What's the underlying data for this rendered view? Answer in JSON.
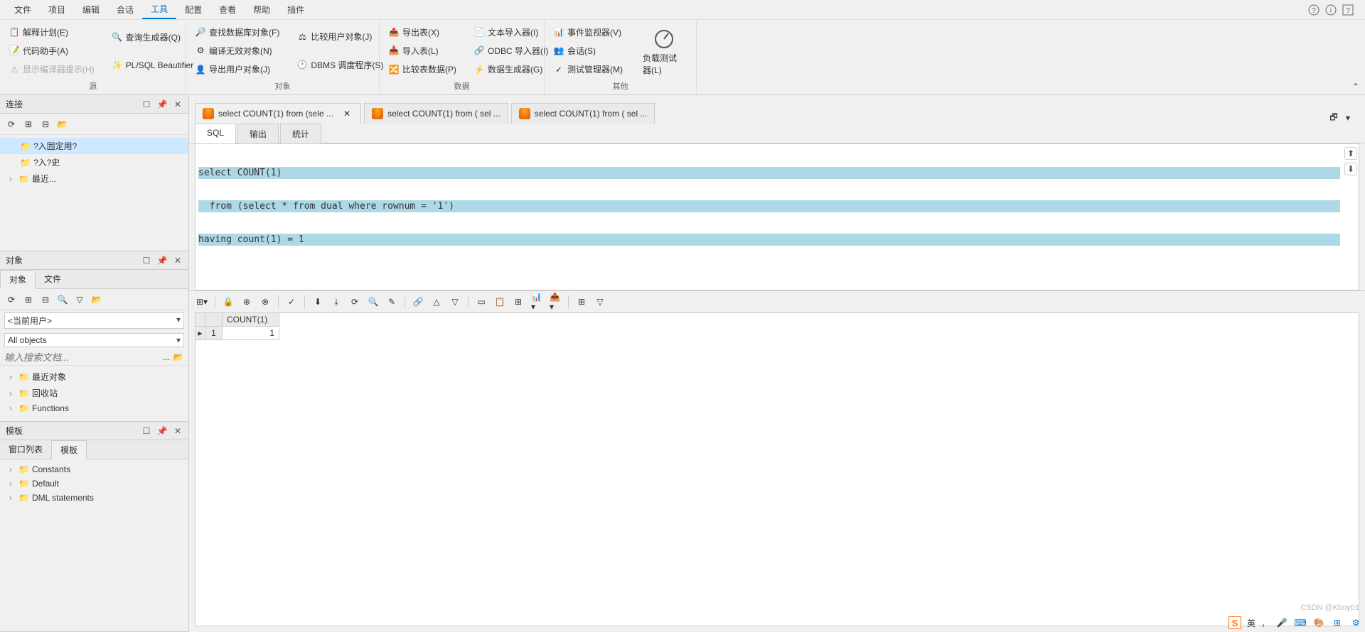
{
  "menu": {
    "items": [
      "文件",
      "项目",
      "编辑",
      "会话",
      "工具",
      "配置",
      "查看",
      "帮助",
      "插件"
    ],
    "active_index": 4
  },
  "ribbon": {
    "groups": [
      {
        "label": "源",
        "cols": [
          [
            {
              "t": "解释计划(E)"
            },
            {
              "t": "代码助手(A)"
            },
            {
              "t": "显示编译器提示(H)",
              "disabled": true
            }
          ],
          [
            {
              "t": "查询生成器(Q)"
            },
            {
              "t": "PL/SQL Beautifier"
            }
          ]
        ]
      },
      {
        "label": "对象",
        "cols": [
          [
            {
              "t": "查找数据库对象(F)"
            },
            {
              "t": "编译无效对象(N)"
            },
            {
              "t": "导出用户对象(J)"
            }
          ],
          [
            {
              "t": "比较用户对象(J)"
            },
            {
              "t": "DBMS 调度程序(S)"
            }
          ]
        ]
      },
      {
        "label": "数据",
        "cols": [
          [
            {
              "t": "导出表(X)"
            },
            {
              "t": "导入表(L)"
            },
            {
              "t": "比较表数据(P)"
            }
          ],
          [
            {
              "t": "文本导入器(I)"
            },
            {
              "t": "ODBC 导入器(I)"
            },
            {
              "t": "数据生成器(G)"
            }
          ]
        ]
      },
      {
        "label": "其他",
        "cols": [
          [
            {
              "t": "事件监视器(V)"
            },
            {
              "t": "会话(S)"
            },
            {
              "t": "测试管理器(M)"
            }
          ]
        ],
        "big": {
          "t": "负载测试器(L)"
        }
      }
    ]
  },
  "panels": {
    "connection": {
      "title": "连接",
      "tree": [
        {
          "label": "?入固定用?",
          "selected": true,
          "indent": 1
        },
        {
          "label": "?入?史",
          "indent": 1
        },
        {
          "label": "最近...",
          "indent": 1,
          "expander": true
        }
      ]
    },
    "objects": {
      "title": "对象",
      "tabs": [
        "对象",
        "文件"
      ],
      "active_tab": 0,
      "combo1": "<当前用户>",
      "combo2": "All objects",
      "search_ph": "输入搜索文档...",
      "tree": [
        {
          "label": "最近对象"
        },
        {
          "label": "回收站"
        },
        {
          "label": "Functions"
        }
      ]
    },
    "templates": {
      "title": "模板",
      "tabs": [
        "窗口列表",
        "模板"
      ],
      "active_tab": 1,
      "tree": [
        {
          "label": "Constants"
        },
        {
          "label": "Default"
        },
        {
          "label": "DML statements"
        }
      ]
    }
  },
  "doc_tabs": [
    {
      "label": "select COUNT(1) from (sele ...",
      "active": true,
      "closable": true
    },
    {
      "label": "select COUNT(1) from ( sel ..."
    },
    {
      "label": "select COUNT(1) from ( sel ..."
    }
  ],
  "sub_tabs": [
    "SQL",
    "输出",
    "统计"
  ],
  "sub_tab_active": 0,
  "editor_lines": [
    {
      "t": "select COUNT(1)",
      "sel": true
    },
    {
      "t": "  from (select * from dual where rownum = '1')",
      "sel": true
    },
    {
      "t": "having count(1) = 1",
      "sel": true
    },
    {
      "t": "",
      "sel": false
    }
  ],
  "result": {
    "columns": [
      "COUNT(1)"
    ],
    "rows": [
      [
        "1",
        "1"
      ]
    ]
  },
  "watermark": "CSDN @Kboy01",
  "tray": {
    "ime": "英",
    "dot": "，"
  }
}
